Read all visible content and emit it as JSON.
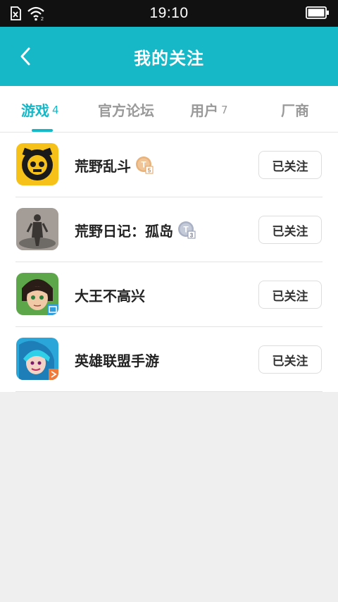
{
  "status_bar": {
    "time": "19:10"
  },
  "header": {
    "title": "我的关注"
  },
  "tabs": [
    {
      "label": "游戏",
      "count": "4",
      "active": true
    },
    {
      "label": "官方论坛",
      "count": ""
    },
    {
      "label": "用户",
      "count": "7"
    },
    {
      "label": "厂商",
      "count": ""
    }
  ],
  "games": [
    {
      "name": "荒野乱斗",
      "badge": "gold-t-badge-icon",
      "follow_label": "已关注"
    },
    {
      "name": "荒野日记：孤岛",
      "badge": "silver-t-badge-icon",
      "follow_label": "已关注"
    },
    {
      "name": "大王不高兴",
      "badge": "",
      "follow_label": "已关注"
    },
    {
      "name": "英雄联盟手游",
      "badge": "",
      "follow_label": "已关注"
    }
  ],
  "colors": {
    "accent": "#16b8c8",
    "background": "#efefef"
  }
}
